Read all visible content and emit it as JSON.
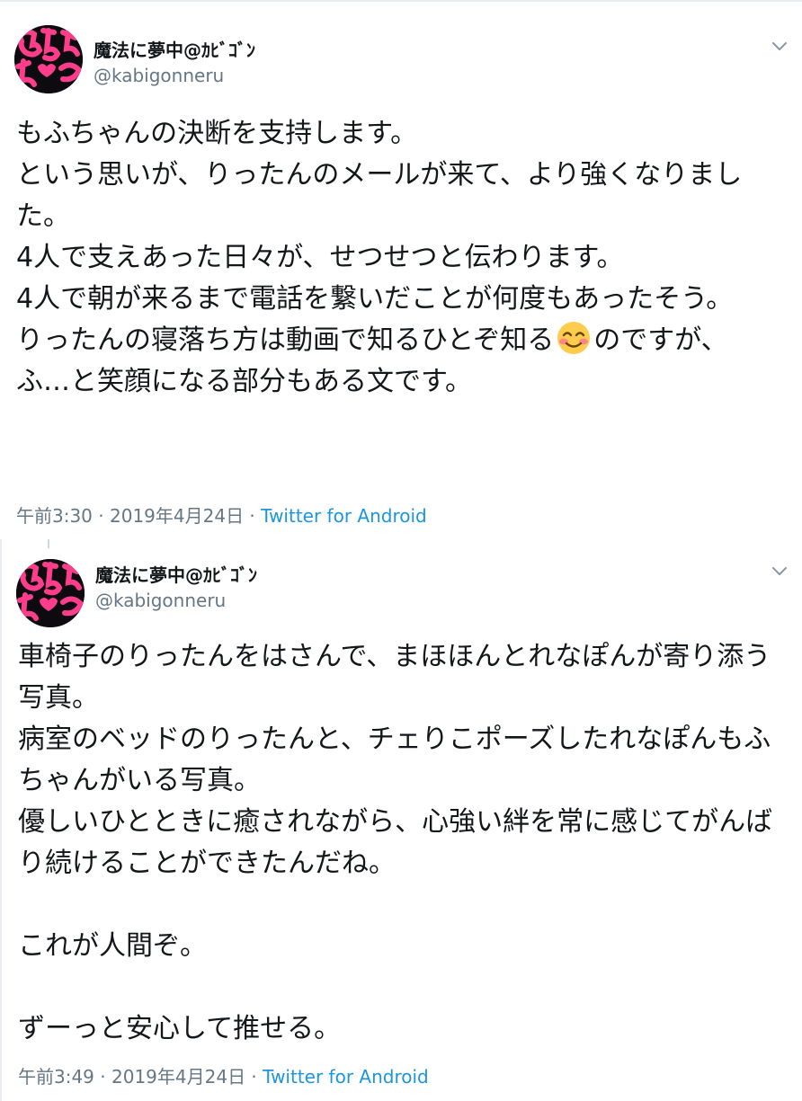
{
  "tweets": [
    {
      "display_name": "魔法に夢中@ｶﾋﾞｺﾞﾝ",
      "handle": "@kabigonneru",
      "lines_before_emoji": "もふちゃんの決断を支持します。\nという思いが、りったんのメールが来て、より強くなりました。\n4人で支えあった日々が、せつせつと伝わります。\n4人で朝が来るまで電話を繋いだことが何度もあったそう。\nりったんの寝落ち方は動画で知るひとぞ知る",
      "emoji": "smiling-face-with-smiling-eyes",
      "lines_after_emoji": "のですが、\nふ…と笑顔になる部分もある文です。",
      "time": "午前3:30",
      "date": "2019年4月24日",
      "source": "Twitter for Android"
    },
    {
      "display_name": "魔法に夢中@ｶﾋﾞｺﾞﾝ",
      "handle": "@kabigonneru",
      "text": "車椅子のりったんをはさんで、まほほんとれなぽんが寄り添う写真。\n病室のベッドのりったんと、チェりこポーズしたれなぽんもふちゃんがいる写真。\n優しいひとときに癒されながら、心強い絆を常に感じてがんばり続けることができたんだね。\n\nこれが人間ぞ。\n\nずーっと安心して推せる。",
      "time": "午前3:49",
      "date": "2019年4月24日",
      "source": "Twitter for Android"
    }
  ],
  "separator": " · ",
  "colors": {
    "text": "#14171a",
    "muted": "#657786",
    "link": "#1b95e0",
    "border": "#e6ecf0",
    "avatar_bg": "#0d0b10",
    "avatar_letters": "#ff3d8b"
  }
}
